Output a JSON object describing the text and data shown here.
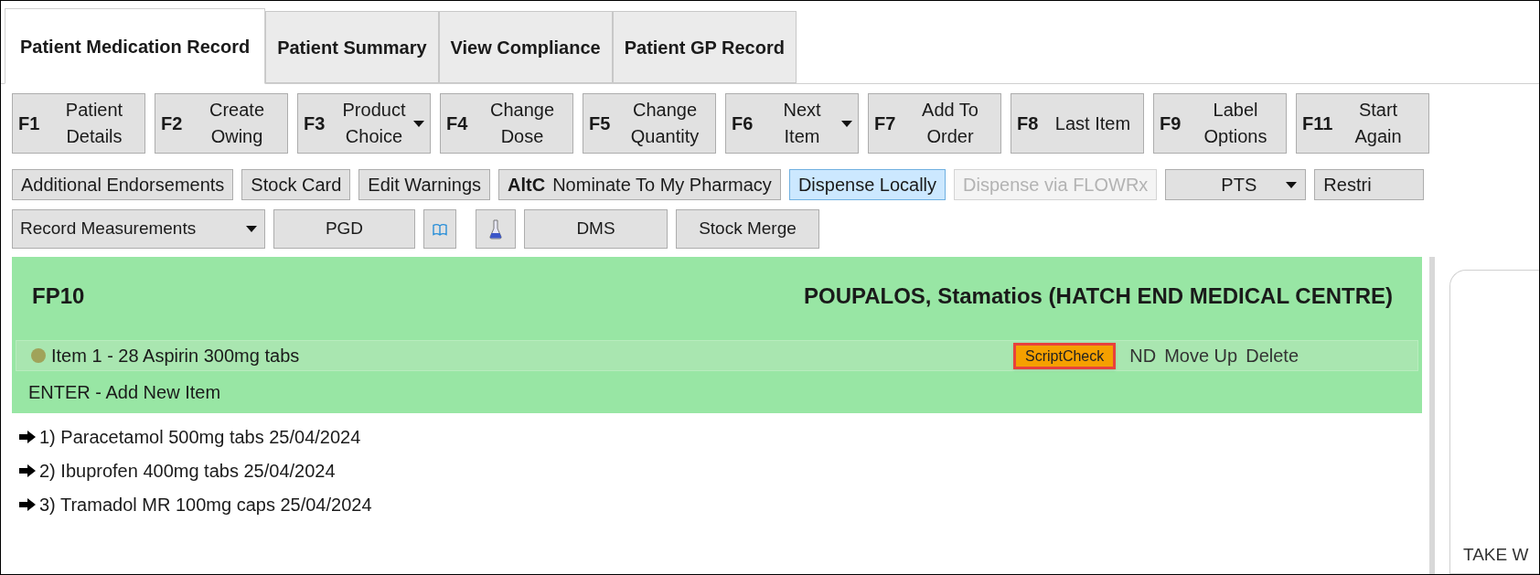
{
  "tabs": [
    {
      "label": "Patient Medication Record",
      "selected": true
    },
    {
      "label": "Patient Summary",
      "selected": false
    },
    {
      "label": "View Compliance",
      "selected": false
    },
    {
      "label": "Patient GP Record",
      "selected": false
    }
  ],
  "function_keys": [
    {
      "key": "F1",
      "label": "Patient Details",
      "dropdown": false
    },
    {
      "key": "F2",
      "label": "Create Owing",
      "dropdown": false
    },
    {
      "key": "F3",
      "label": "Product Choice",
      "dropdown": true
    },
    {
      "key": "F4",
      "label": "Change Dose",
      "dropdown": false
    },
    {
      "key": "F5",
      "label": "Change Quantity",
      "dropdown": false
    },
    {
      "key": "F6",
      "label": "Next Item",
      "dropdown": true
    },
    {
      "key": "F7",
      "label": "Add To Order",
      "dropdown": false
    },
    {
      "key": "F8",
      "label": "Last Item",
      "dropdown": false
    },
    {
      "key": "F9",
      "label": "Label Options",
      "dropdown": false
    },
    {
      "key": "F11",
      "label": "Start Again",
      "dropdown": false
    }
  ],
  "toolbar": [
    {
      "kind": "button",
      "label": "Additional Endorsements",
      "selected": false,
      "disabled": false
    },
    {
      "kind": "button",
      "label": "Stock Card",
      "selected": false,
      "disabled": false
    },
    {
      "kind": "button",
      "label": "Edit Warnings",
      "selected": false,
      "disabled": false
    },
    {
      "kind": "keyed",
      "key": "AltC",
      "label": "Nominate To My Pharmacy",
      "selected": false,
      "disabled": false
    },
    {
      "kind": "button",
      "label": "Dispense Locally",
      "selected": true,
      "disabled": false
    },
    {
      "kind": "button",
      "label": "Dispense via FLOWRx",
      "selected": false,
      "disabled": true
    },
    {
      "kind": "dropdown",
      "label": "PTS",
      "selected": false,
      "disabled": false
    },
    {
      "kind": "button",
      "label": "Restri",
      "selected": false,
      "disabled": false
    }
  ],
  "toolbar_2": [
    {
      "kind": "dropdown",
      "label": "Record Measurements"
    },
    {
      "kind": "button",
      "label": "PGD"
    },
    {
      "kind": "book"
    },
    {
      "kind": "flask"
    },
    {
      "kind": "button",
      "label": "DMS"
    },
    {
      "kind": "button",
      "label": "Stock Merge"
    }
  ],
  "form": {
    "title": "FP10",
    "patient": "POUPALOS, Stamatios (HATCH END MEDICAL CENTRE)",
    "items": [
      {
        "label": "Item 1 - 28 Aspirin 300mg tabs",
        "color": "#a0a35a",
        "actions": [
          {
            "kind": "highlight",
            "label": "ScriptCheck"
          },
          {
            "kind": "link",
            "label": "ND"
          },
          {
            "kind": "link",
            "label": "Move Up"
          },
          {
            "kind": "link",
            "label": "Delete"
          }
        ]
      }
    ],
    "add_item": "ENTER - Add New Item",
    "history": [
      "1) Paracetamol 500mg tabs 25/04/2024",
      "2) Ibuprofen 400mg tabs 25/04/2024",
      "3) Tramadol MR 100mg caps 25/04/2024"
    ]
  },
  "side_panel": {
    "text": "TAKE W"
  }
}
